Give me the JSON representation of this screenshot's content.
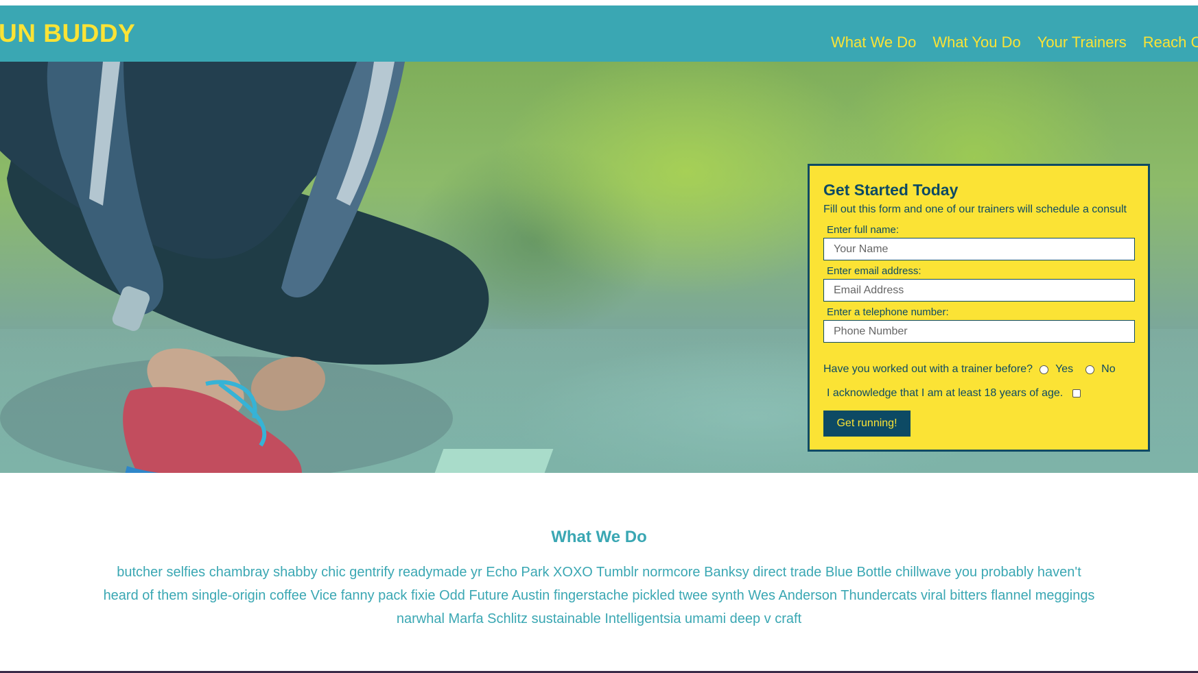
{
  "header": {
    "brand": "UN BUDDY",
    "nav": [
      "What We Do",
      "What You Do",
      "Your Trainers",
      "Reach C"
    ]
  },
  "form": {
    "title": "Get Started Today",
    "subtitle": "Fill out this form and one of our trainers will schedule a consult",
    "name_label": "Enter full name:",
    "name_placeholder": "Your Name",
    "email_label": "Enter email address:",
    "email_placeholder": "Email Address",
    "phone_label": "Enter a telephone number:",
    "phone_placeholder": "Phone Number",
    "trainer_question": "Have you worked out with a trainer before?",
    "yes_label": "Yes",
    "no_label": "No",
    "age_ack": "I acknowledge that I am at least 18 years of age.",
    "submit_label": "Get running!"
  },
  "section": {
    "title": "What We Do",
    "text": "butcher selfies chambray shabby chic gentrify readymade yr Echo Park XOXO Tumblr normcore Banksy direct trade Blue Bottle chillwave you probably haven't heard of them single-origin coffee Vice fanny pack fixie Odd Future Austin fingerstache pickled twee synth Wes Anderson Thundercats viral bitters flannel meggings narwhal Marfa Schlitz sustainable Intelligentsia umami deep v craft"
  },
  "colors": {
    "teal": "#3aa7b3",
    "yellow": "#fbe335",
    "navy": "#0d4a64"
  }
}
